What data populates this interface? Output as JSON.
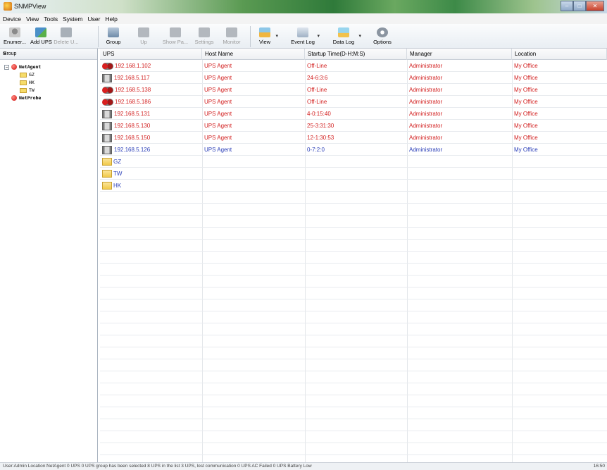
{
  "window": {
    "title": "SNMPView"
  },
  "menu": [
    "Device",
    "View",
    "Tools",
    "System",
    "User",
    "Help"
  ],
  "toolbar": {
    "enumerate": "Enumer...",
    "add_ups": "Add UPS",
    "delete_ups": "Delete U...",
    "group": "Group",
    "up": "Up",
    "show_panel": "Show Pa...",
    "settings": "Settings",
    "monitor": "Monitor",
    "view": "View",
    "event_log": "Event Log",
    "data_log": "Data Log",
    "options": "Options"
  },
  "left_panel": {
    "title": "Group",
    "close": "×",
    "tree": [
      {
        "label": "NetAgent",
        "children": [
          "GZ",
          "HK",
          "TW"
        ]
      },
      {
        "label": "NetProbe",
        "children": []
      }
    ]
  },
  "table": {
    "columns": [
      "UPS",
      "Host Name",
      "Startup Time(D-H:M:S)",
      "Manager",
      "Location"
    ],
    "rows": [
      {
        "ups": "192.168.1.102",
        "host": "UPS Agent",
        "startup": "Off-Line",
        "manager": "Administrator",
        "location": "My Office",
        "status": "offline",
        "color": "#d21f1f"
      },
      {
        "ups": "192.168.5.117",
        "host": "UPS Agent",
        "startup": "24-6:3:6",
        "manager": "Administrator",
        "location": "My Office",
        "status": "online",
        "color": "#d21f1f"
      },
      {
        "ups": "192.168.5.138",
        "host": "UPS Agent",
        "startup": "Off-Line",
        "manager": "Administrator",
        "location": "My Office",
        "status": "offline",
        "color": "#d21f1f"
      },
      {
        "ups": "192.168.5.186",
        "host": "UPS Agent",
        "startup": "Off-Line",
        "manager": "Administrator",
        "location": "My Office",
        "status": "offline",
        "color": "#d21f1f"
      },
      {
        "ups": "192.168.5.131",
        "host": "UPS Agent",
        "startup": "4-0:15:40",
        "manager": "Administrator",
        "location": "My Office",
        "status": "online",
        "color": "#d21f1f"
      },
      {
        "ups": "192.168.5.130",
        "host": "UPS Agent",
        "startup": "25-3:31:30",
        "manager": "Administrator",
        "location": "My Office",
        "status": "online",
        "color": "#d21f1f"
      },
      {
        "ups": "192.168.5.150",
        "host": "UPS Agent",
        "startup": "12-1:30:53",
        "manager": "Administrator",
        "location": "My Office",
        "status": "online",
        "color": "#d21f1f"
      },
      {
        "ups": "192.168.5.126",
        "host": "UPS Agent",
        "startup": "0-7:2:0",
        "manager": "Administrator",
        "location": "My Office",
        "status": "online",
        "color": "#2b3fb8"
      }
    ],
    "groups": [
      "GZ",
      "TW",
      "HK"
    ]
  },
  "status_bar": {
    "text": "User:Admin  Location:NetAgent  0 UPS 0 UPS group has been selected  8 UPS in the list 3 UPS, lost communication 0 UPS AC Failed 0 UPS Battery Low",
    "clock": "16:50"
  }
}
